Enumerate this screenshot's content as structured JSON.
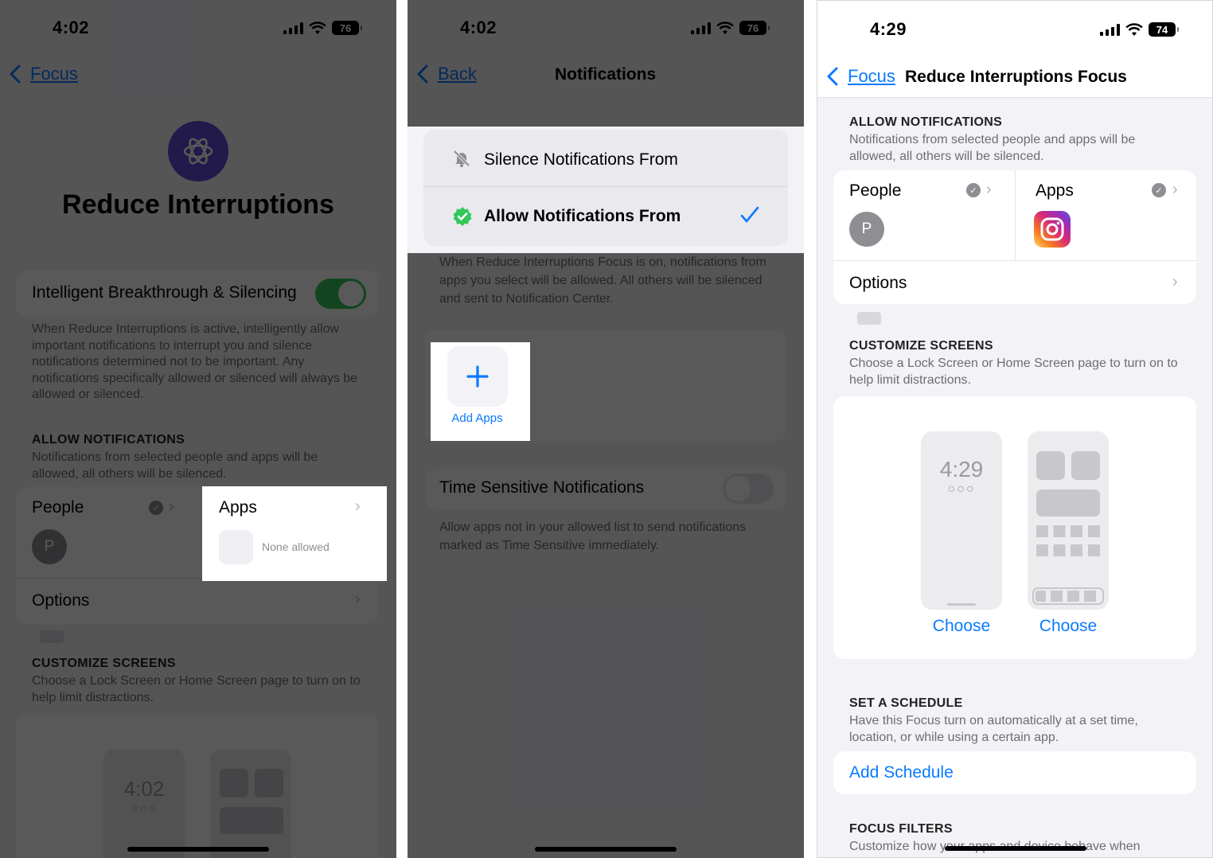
{
  "panel1": {
    "time": "4:02",
    "battery": "76",
    "back_label": "Focus",
    "title": "Reduce Interruptions",
    "breakthrough": {
      "label": "Intelligent Breakthrough & Silencing",
      "description": "When Reduce Interruptions is active, intelligently allow important notifications to interrupt you and silence notifications determined not to be important. Any notifications specifically allowed or silenced will always be allowed or silenced."
    },
    "allow_notifications": {
      "header": "ALLOW NOTIFICATIONS",
      "description": "Notifications from selected people and apps will be allowed, all others will be silenced."
    },
    "people_label": "People",
    "people_avatar": "P",
    "apps_label": "Apps",
    "apps_none": "None allowed",
    "options_label": "Options",
    "customize": {
      "header": "CUSTOMIZE SCREENS",
      "description": "Choose a Lock Screen or Home Screen page to turn on to help limit distractions."
    },
    "lock_time": "4:02"
  },
  "panel2": {
    "time": "4:02",
    "battery": "76",
    "back_label": "Back",
    "title": "Notifications",
    "silence_label": "Silence Notifications From",
    "allow_label": "Allow Notifications From",
    "allow_description": "When Reduce Interruptions Focus is on, notifications from apps you select will be allowed. All others will be silenced and sent to Notification Center.",
    "add_apps_label": "Add Apps",
    "time_sensitive_label": "Time Sensitive Notifications",
    "time_sensitive_description": "Allow apps not in your allowed list to send notifications marked as Time Sensitive immediately."
  },
  "panel3": {
    "time": "4:29",
    "battery": "74",
    "back_label": "Focus",
    "title": "Reduce Interruptions Focus",
    "allow_notifications": {
      "header": "ALLOW NOTIFICATIONS",
      "description": "Notifications from selected people and apps will be allowed, all others will be silenced."
    },
    "people_label": "People",
    "people_avatar": "P",
    "apps_label": "Apps",
    "options_label": "Options",
    "customize": {
      "header": "CUSTOMIZE SCREENS",
      "description": "Choose a Lock Screen or Home Screen page to turn on to help limit distractions."
    },
    "lock_time": "4:29",
    "choose_lock": "Choose",
    "choose_home": "Choose",
    "schedule": {
      "header": "SET A SCHEDULE",
      "description": "Have this Focus turn on automatically at a set time, location, or while using a certain app.",
      "add_label": "Add Schedule"
    },
    "filters": {
      "header": "FOCUS FILTERS",
      "description": "Customize how your apps and device behave when"
    }
  },
  "colors": {
    "accent": "#0a7aff",
    "toggle_on": "#34c759",
    "focus_purple": "#5e4ad8"
  }
}
